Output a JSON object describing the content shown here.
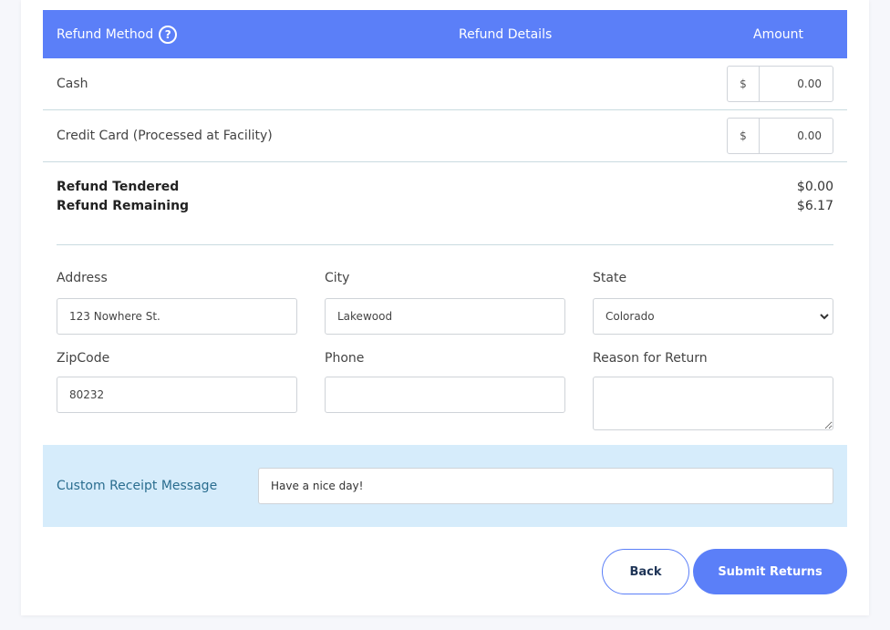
{
  "header": {
    "refund_method": "Refund Method",
    "help_icon": "?",
    "refund_details": "Refund Details",
    "amount": "Amount"
  },
  "methods": [
    {
      "label": "Cash",
      "currency": "$",
      "value": "0.00"
    },
    {
      "label": "Credit Card (Processed at Facility)",
      "currency": "$",
      "value": "0.00"
    }
  ],
  "totals": {
    "tendered_label": "Refund Tendered",
    "tendered_value": "$0.00",
    "remaining_label": "Refund Remaining",
    "remaining_value": "$6.17"
  },
  "form": {
    "address_label": "Address",
    "address_value": "123 Nowhere St.",
    "city_label": "City",
    "city_value": "Lakewood",
    "state_label": "State",
    "state_value": "Colorado",
    "zip_label": "ZipCode",
    "zip_value": "80232",
    "phone_label": "Phone",
    "phone_value": "",
    "reason_label": "Reason for Return",
    "reason_value": ""
  },
  "receipt": {
    "label": "Custom Receipt Message",
    "value": "Have a nice day!"
  },
  "buttons": {
    "back": "Back",
    "submit": "Submit Returns"
  },
  "colors": {
    "accent": "#5b7ff8",
    "receipt_bg": "#d6ecfb",
    "receipt_label": "#2a6d8f"
  },
  "icons": {
    "help": "help-circle-icon",
    "select": "chevron-down-icon"
  }
}
